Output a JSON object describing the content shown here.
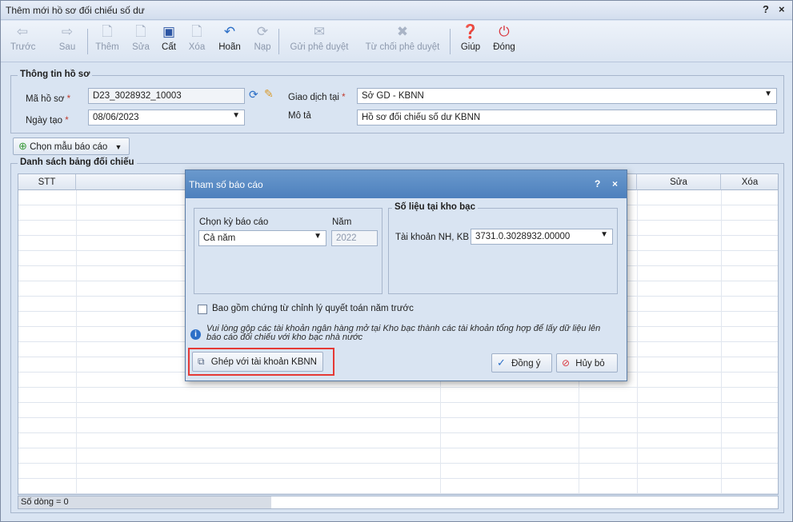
{
  "window": {
    "title": "Thêm mới hồ sơ đối chiếu số dư",
    "help": "?",
    "close": "×"
  },
  "toolbar": {
    "back": "Trước",
    "forward": "Sau",
    "add": "Thêm",
    "edit": "Sửa",
    "save": "Cất",
    "delete": "Xóa",
    "undo": "Hoãn",
    "load": "Nạp",
    "send": "Gửi phê duyệt",
    "reject": "Từ chối phê duyệt",
    "help": "Giúp",
    "close": "Đóng"
  },
  "info": {
    "title": "Thông tin hồ sơ",
    "code_label": "Mã hồ sơ",
    "code_value": "D23_3028932_10003",
    "date_label": "Ngày tạo",
    "date_value": "08/06/2023",
    "trans_label": "Giao dịch tại",
    "trans_value": "Sở GD - KBNN",
    "desc_label": "Mô tả",
    "desc_value": "Hồ sơ đối chiếu số dư KBNN",
    "required": "*"
  },
  "choose_template": "Chọn mẫu báo cáo",
  "list": {
    "title": "Danh sách bảng đối chiếu",
    "col_stt": "STT",
    "col_edit": "Sửa",
    "col_delete": "Xóa",
    "row_count": "Số dòng = 0"
  },
  "dialog": {
    "title": "Tham số báo cáo",
    "help": "?",
    "close": "×",
    "period_label": "Chọn kỳ báo cáo",
    "year_label": "Năm",
    "period_value": "Cả năm",
    "year_value": "2022",
    "treasury_title": "Số liệu tại kho bạc",
    "account_label": "Tài khoản NH, KB",
    "account_value": "3731.0.3028932.00000",
    "include_label": "Bao gồm chứng từ chỉnh lý quyết toán năm trước",
    "note": "Vui lòng gộp các tài khoản ngân hàng mở tại Kho bạc thành các tài khoản tổng hợp để lấy dữ liệu lên báo cáo đối chiếu với kho bạc nhà nước",
    "merge_button": "Ghép với tài khoản KBNN",
    "ok_button": "Đồng ý",
    "cancel_button": "Hủy bỏ"
  },
  "colors": {
    "title_bar": "#4d80bd",
    "highlight": "#e53935"
  }
}
